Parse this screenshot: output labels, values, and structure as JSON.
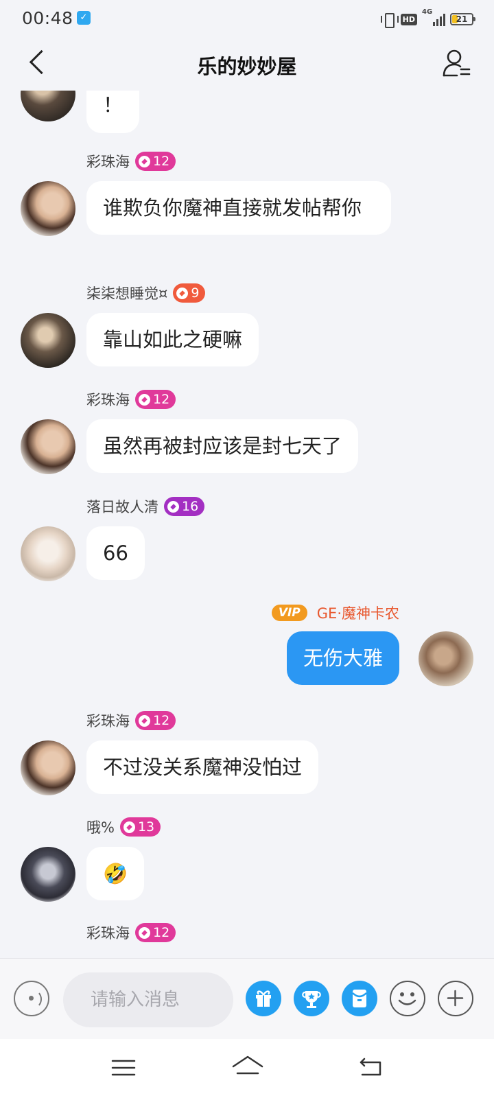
{
  "status_bar": {
    "time": "00:48",
    "network_label": "4G",
    "hd_label": "HD",
    "battery_level": "21",
    "battery_color": "#f3c021"
  },
  "header": {
    "title": "乐的妙妙屋"
  },
  "messages": [
    {
      "sender": "",
      "level": "",
      "text": "！",
      "side": "left"
    },
    {
      "sender": "彩珠海",
      "level": "12",
      "text": "谁欺负你魔神直接就发帖帮你",
      "side": "left"
    },
    {
      "sender": "柒柒想睡觉¤",
      "level": "9",
      "text": "靠山如此之硬嘛",
      "side": "left"
    },
    {
      "sender": "彩珠海",
      "level": "12",
      "text": "虽然再被封应该是封七天了",
      "side": "left"
    },
    {
      "sender": "落日故人清",
      "level": "16",
      "text": "66",
      "side": "left"
    },
    {
      "sender": "GE·魔神卡农",
      "level": "",
      "vip_label": "VIP",
      "text": "无伤大雅",
      "side": "right"
    },
    {
      "sender": "彩珠海",
      "level": "12",
      "text": "不过没关系魔神没怕过",
      "side": "left"
    },
    {
      "sender": "哦%",
      "level": "13",
      "text": "🤣",
      "side": "left"
    },
    {
      "sender": "彩珠海",
      "level": "12",
      "text": "",
      "side": "left"
    }
  ],
  "composer": {
    "placeholder": "请输入消息"
  },
  "colors": {
    "accent": "#2b97f3",
    "badge_pink": "#e0399a",
    "badge_red": "#f05a3c",
    "badge_purple": "#a32fc2",
    "vip_orange": "#f29a1f",
    "vip_name": "#e8582f"
  }
}
